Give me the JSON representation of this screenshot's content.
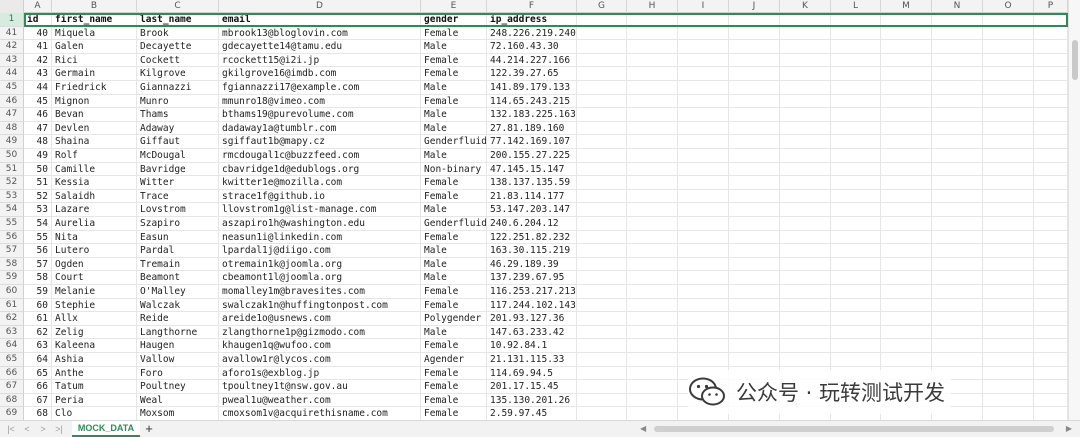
{
  "sheet": {
    "columns": [
      "A",
      "B",
      "C",
      "D",
      "E",
      "F",
      "G",
      "H",
      "I",
      "J",
      "K",
      "L",
      "M",
      "N",
      "O",
      "P"
    ],
    "header_row_number": "1",
    "headers": [
      "id",
      "first_name",
      "last_name",
      "email",
      "gender",
      "ip_address"
    ],
    "rows": [
      {
        "n": "41",
        "id": "40",
        "first_name": "Miquela",
        "last_name": "Brook",
        "email": "mbrook13@bloglovin.com",
        "gender": "Female",
        "ip": "248.226.219.240"
      },
      {
        "n": "42",
        "id": "41",
        "first_name": "Galen",
        "last_name": "Decayette",
        "email": "gdecayette14@tamu.edu",
        "gender": "Male",
        "ip": "72.160.43.30"
      },
      {
        "n": "43",
        "id": "42",
        "first_name": "Rici",
        "last_name": "Cockett",
        "email": "rcockett15@i2i.jp",
        "gender": "Female",
        "ip": "44.214.227.166"
      },
      {
        "n": "44",
        "id": "43",
        "first_name": "Germain",
        "last_name": "Kilgrove",
        "email": "gkilgrove16@imdb.com",
        "gender": "Female",
        "ip": "122.39.27.65"
      },
      {
        "n": "45",
        "id": "44",
        "first_name": "Friedrick",
        "last_name": "Giannazzi",
        "email": "fgiannazzi17@example.com",
        "gender": "Male",
        "ip": "141.89.179.133"
      },
      {
        "n": "46",
        "id": "45",
        "first_name": "Mignon",
        "last_name": "Munro",
        "email": "mmunro18@vimeo.com",
        "gender": "Female",
        "ip": "114.65.243.215"
      },
      {
        "n": "47",
        "id": "46",
        "first_name": "Bevan",
        "last_name": "Thams",
        "email": "bthams19@purevolume.com",
        "gender": "Male",
        "ip": "132.183.225.163"
      },
      {
        "n": "48",
        "id": "47",
        "first_name": "Devlen",
        "last_name": "Adaway",
        "email": "dadaway1a@tumblr.com",
        "gender": "Male",
        "ip": "27.81.189.160"
      },
      {
        "n": "49",
        "id": "48",
        "first_name": "Shaina",
        "last_name": "Giffaut",
        "email": "sgiffaut1b@mapy.cz",
        "gender": "Genderfluid",
        "ip": "77.142.169.107"
      },
      {
        "n": "50",
        "id": "49",
        "first_name": "Rolf",
        "last_name": "McDougal",
        "email": "rmcdougal1c@buzzfeed.com",
        "gender": "Male",
        "ip": "200.155.27.225"
      },
      {
        "n": "51",
        "id": "50",
        "first_name": "Camille",
        "last_name": "Bavridge",
        "email": "cbavridge1d@edublogs.org",
        "gender": "Non-binary",
        "ip": "47.145.15.147"
      },
      {
        "n": "52",
        "id": "51",
        "first_name": "Kessia",
        "last_name": "Witter",
        "email": "kwitter1e@mozilla.com",
        "gender": "Female",
        "ip": "138.137.135.59"
      },
      {
        "n": "53",
        "id": "52",
        "first_name": "Salaidh",
        "last_name": "Trace",
        "email": "strace1f@github.io",
        "gender": "Female",
        "ip": "21.83.114.177"
      },
      {
        "n": "54",
        "id": "53",
        "first_name": "Lazare",
        "last_name": "Lovstrom",
        "email": "llovstrom1g@list-manage.com",
        "gender": "Male",
        "ip": "53.147.203.147"
      },
      {
        "n": "55",
        "id": "54",
        "first_name": "Aurelia",
        "last_name": "Szapiro",
        "email": "aszapiro1h@washington.edu",
        "gender": "Genderfluid",
        "ip": "240.6.204.12"
      },
      {
        "n": "56",
        "id": "55",
        "first_name": "Nita",
        "last_name": "Easun",
        "email": "neasun1i@linkedin.com",
        "gender": "Female",
        "ip": "122.251.82.232"
      },
      {
        "n": "57",
        "id": "56",
        "first_name": "Lutero",
        "last_name": "Pardal",
        "email": "lpardal1j@diigo.com",
        "gender": "Male",
        "ip": "163.30.115.219"
      },
      {
        "n": "58",
        "id": "57",
        "first_name": "Ogden",
        "last_name": "Tremain",
        "email": "otremain1k@joomla.org",
        "gender": "Male",
        "ip": "46.29.189.39"
      },
      {
        "n": "59",
        "id": "58",
        "first_name": "Court",
        "last_name": "Beamont",
        "email": "cbeamont1l@joomla.org",
        "gender": "Male",
        "ip": "137.239.67.95"
      },
      {
        "n": "60",
        "id": "59",
        "first_name": "Melanie",
        "last_name": "O'Malley",
        "email": "momalley1m@bravesites.com",
        "gender": "Female",
        "ip": "116.253.217.213"
      },
      {
        "n": "61",
        "id": "60",
        "first_name": "Stephie",
        "last_name": "Walczak",
        "email": "swalczak1n@huffingtonpost.com",
        "gender": "Female",
        "ip": "117.244.102.143"
      },
      {
        "n": "62",
        "id": "61",
        "first_name": "Allx",
        "last_name": "Reide",
        "email": "areide1o@usnews.com",
        "gender": "Polygender",
        "ip": "201.93.127.36"
      },
      {
        "n": "63",
        "id": "62",
        "first_name": "Zelig",
        "last_name": "Langthorne",
        "email": "zlangthorne1p@gizmodo.com",
        "gender": "Male",
        "ip": "147.63.233.42"
      },
      {
        "n": "64",
        "id": "63",
        "first_name": "Kaleena",
        "last_name": "Haugen",
        "email": "khaugen1q@wufoo.com",
        "gender": "Female",
        "ip": "10.92.84.1"
      },
      {
        "n": "65",
        "id": "64",
        "first_name": "Ashia",
        "last_name": "Vallow",
        "email": "avallow1r@lycos.com",
        "gender": "Agender",
        "ip": "21.131.115.33"
      },
      {
        "n": "66",
        "id": "65",
        "first_name": "Anthe",
        "last_name": "Foro",
        "email": "aforo1s@exblog.jp",
        "gender": "Female",
        "ip": "114.69.94.5"
      },
      {
        "n": "67",
        "id": "66",
        "first_name": "Tatum",
        "last_name": "Poultney",
        "email": "tpoultney1t@nsw.gov.au",
        "gender": "Female",
        "ip": "201.17.15.45"
      },
      {
        "n": "68",
        "id": "67",
        "first_name": "Peria",
        "last_name": "Weal",
        "email": "pweal1u@weather.com",
        "gender": "Female",
        "ip": "135.130.201.26"
      },
      {
        "n": "69",
        "id": "68",
        "first_name": "Clo",
        "last_name": "Moxsom",
        "email": "cmoxsom1v@acquirethisname.com",
        "gender": "Female",
        "ip": "2.59.97.45"
      }
    ]
  },
  "tabbar": {
    "sheet_tab": "MOCK_DATA",
    "add_label": "+",
    "nav_first": "|<",
    "nav_prev": "<",
    "nav_next": ">",
    "nav_last": ">|"
  },
  "watermark": {
    "text": "公众号 · 玩转测试开发"
  },
  "colors": {
    "accent": "#2e8b57"
  }
}
